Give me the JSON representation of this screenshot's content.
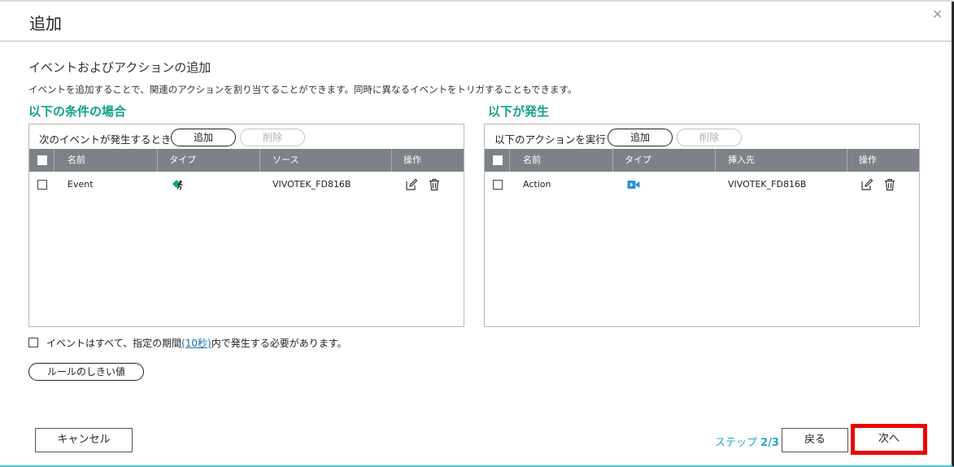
{
  "dialog": {
    "title": "追加",
    "close_glyph": "✕",
    "subtitle": "イベントおよびアクションの追加",
    "description": "イベントを追加することで、関連のアクションを割り当てることができます。同時に異なるイベントをトリガすることもできます。"
  },
  "left": {
    "section_title": "以下の条件の場合",
    "toolbar_label": "次のイベントが発生するとき",
    "add_label": "追加",
    "delete_label": "削除",
    "columns": [
      "名前",
      "タイプ",
      "ソース",
      "操作"
    ],
    "rows": [
      {
        "name": "Event",
        "type_icon": "person-running-icon",
        "source": "VIVOTEK_FD816B"
      }
    ]
  },
  "right": {
    "section_title": "以下が発生",
    "toolbar_label": "以下のアクションを実行",
    "add_label": "追加",
    "delete_label": "削除",
    "columns": [
      "名前",
      "タイプ",
      "挿入先",
      "操作"
    ],
    "rows": [
      {
        "name": "Action",
        "type_icon": "video-camera-icon",
        "target": "VIVOTEK_FD816B"
      }
    ]
  },
  "condition": {
    "text_before": "イベントはすべて、指定の期間",
    "link": "(10秒)",
    "text_after": "内で発生する必要があります。",
    "checked": false
  },
  "threshold_button": "ルールのしきい値",
  "footer": {
    "cancel_label": "キャンセル",
    "step_prefix": "ステップ",
    "step_value": "2/3",
    "back_label": "戻る",
    "next_label": "次へ"
  },
  "colors": {
    "accent_green": "#12a08a",
    "header_gray": "#7d8289",
    "step_blue": "#2aa5c8",
    "highlight_red": "#ee0000",
    "camera_blue": "#2a8fd6"
  }
}
